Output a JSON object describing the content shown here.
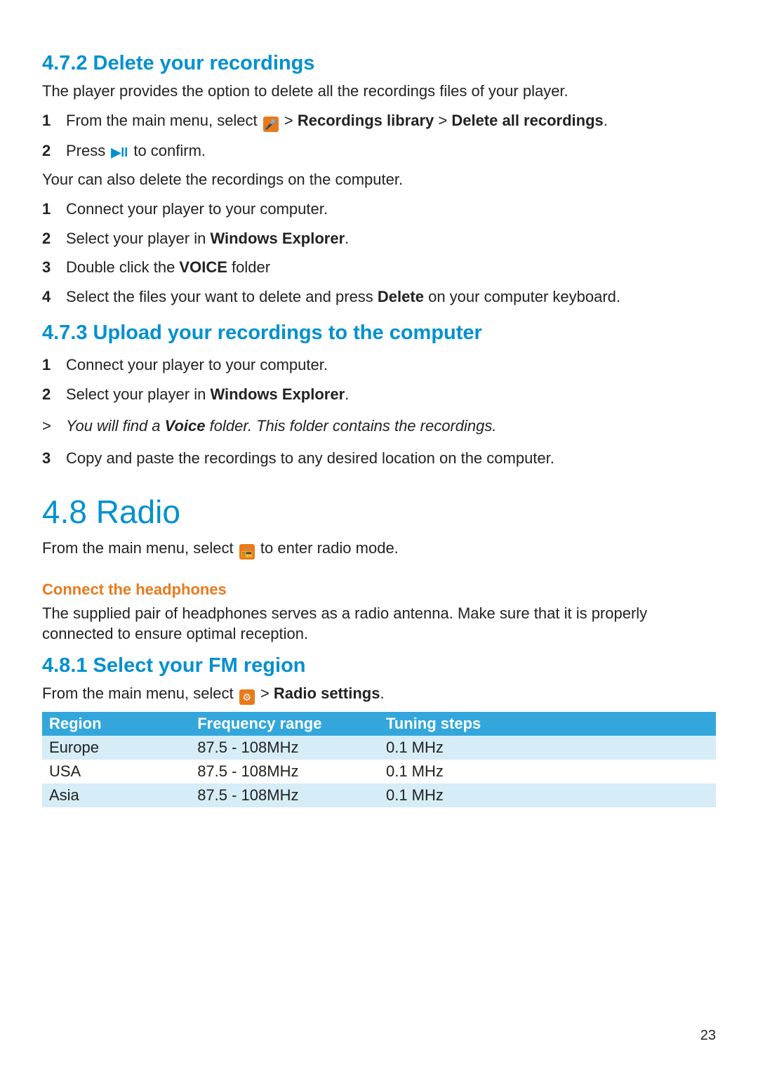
{
  "page_number": "23",
  "section_472": {
    "heading": "4.7.2  Delete your recordings",
    "intro": "The player provides the option to delete all the recordings files of your player.",
    "step1_prefix": "From the main menu, select ",
    "step1_mid": " > ",
    "step1_bold1": "Recordings library",
    "step1_mid2": " > ",
    "step1_bold2": "Delete all recordings",
    "step1_suffix": ".",
    "step2_prefix": "Press ",
    "step2_suffix": " to confirm.",
    "play_glyph": "▶II",
    "mic_glyph": "🎤",
    "para2": "Your can also delete the recordings on the computer.",
    "list2": {
      "i1": "Connect your player to your computer.",
      "i2_prefix": "Select your player in ",
      "i2_bold": "Windows Explorer",
      "i2_suffix": ".",
      "i3_prefix": "Double click the ",
      "i3_bold": "VOICE",
      "i3_suffix": " folder",
      "i4_prefix": "Select the files your want to delete and press ",
      "i4_bold": "Delete",
      "i4_suffix": " on your computer keyboard."
    }
  },
  "section_473": {
    "heading": "4.7.3  Upload your recordings to the computer",
    "i1": "Connect your player to your computer.",
    "i2_prefix": "Select your player in ",
    "i2_bold": "Windows Explorer",
    "i2_suffix": ".",
    "note_prefix": "You will find a ",
    "note_bold": "Voice",
    "note_suffix": " folder. This folder contains the recordings.",
    "i3": "Copy and paste the recordings to any desired location on the computer."
  },
  "section_48": {
    "heading": "4.8  Radio",
    "intro_prefix": "From the main menu, select ",
    "intro_suffix": " to enter radio mode.",
    "radio_glyph": "📻",
    "sub_heading": "Connect the headphones",
    "sub_text": "The supplied pair of headphones serves as a radio antenna. Make sure that it is properly connected to ensure optimal reception."
  },
  "section_481": {
    "heading": "4.8.1 Select your FM region",
    "intro_prefix": "From the main menu, select ",
    "intro_mid": " > ",
    "intro_bold": "Radio settings",
    "intro_suffix": ".",
    "gear_glyph": "⚙",
    "table": {
      "headers": {
        "c1": "Region",
        "c2": "Frequency range",
        "c3": "Tuning steps"
      },
      "rows": [
        {
          "region": "Europe",
          "freq": "87.5 - 108MHz",
          "step": "0.1 MHz"
        },
        {
          "region": "USA",
          "freq": "87.5 - 108MHz",
          "step": "0.1 MHz"
        },
        {
          "region": "Asia",
          "freq": "87.5 - 108MHz",
          "step": "0.1 MHz"
        }
      ]
    }
  }
}
